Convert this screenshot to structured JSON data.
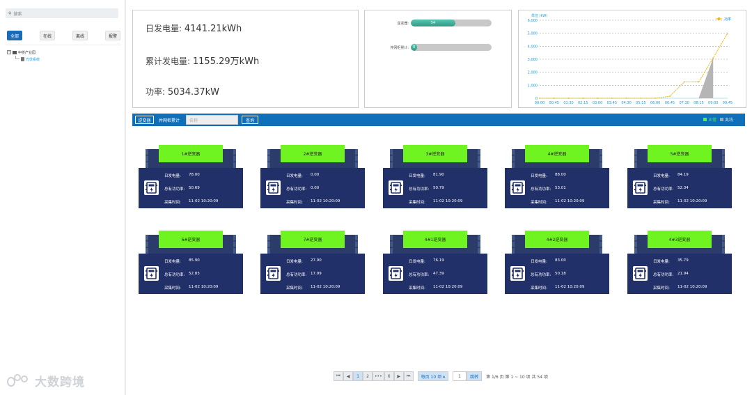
{
  "sidebar": {
    "search_placeholder": "搜索",
    "filters": [
      "全部",
      "在线",
      "离线",
      "报警"
    ],
    "tree_root": "中侨产业园",
    "tree_child": "光伏系统"
  },
  "summary": {
    "daily_label": "日发电量:",
    "daily_value": "4141.21kWh",
    "total_label": "累计发电量:",
    "total_value": "1155.29万kWh",
    "power_label": "功率:",
    "power_value": "5034.37kW"
  },
  "progress": [
    {
      "label": "逆变器:",
      "value": "54",
      "fraction": 0.55
    },
    {
      "label": "并网柜累计:",
      "value": "0",
      "fraction": 0.08
    }
  ],
  "chart_data": {
    "type": "line",
    "ylabel": "kW",
    "ylabel_prefix": "单位",
    "ylim": [
      0,
      6000
    ],
    "yticks": [
      "0",
      "1,000",
      "2,000",
      "3,000",
      "4,000",
      "5,000",
      "6,000"
    ],
    "categories": [
      "00:00",
      "00:45",
      "01:30",
      "02:15",
      "03:00",
      "03:45",
      "04:30",
      "05:15",
      "06:00",
      "06:45",
      "07:30",
      "08:15",
      "09:00",
      "09:45"
    ],
    "series": [
      {
        "name": "功率",
        "color": "#f5b700",
        "values": [
          0,
          0,
          0,
          0,
          0,
          0,
          0,
          0,
          0,
          150,
          1250,
          1250,
          3100,
          5000
        ]
      }
    ],
    "legend": "top-right",
    "grid": true
  },
  "toolbar": {
    "btn_inverter": "逆变器",
    "tab_grid": "并网柜累计",
    "name_placeholder": "名称",
    "btn_query": "查询",
    "legend_online": "正常",
    "legend_offline": "离线",
    "online_color": "#4ef24e",
    "offline_color": "#9aa9b5"
  },
  "card_labels": {
    "daily": "日发电量:",
    "power": "总有功功率:",
    "time": "采集时间:"
  },
  "cards": [
    {
      "name": "1#逆变器",
      "daily": "78.00",
      "power": "50.69",
      "time": "11-02 10:20:09"
    },
    {
      "name": "2#逆变器",
      "daily": "0.00",
      "power": "0.00",
      "time": "11-02 10:20:09"
    },
    {
      "name": "3#逆变器",
      "daily": "81.90",
      "power": "50.79",
      "time": "11-02 10:20:09"
    },
    {
      "name": "4#逆变器",
      "daily": "88.00",
      "power": "53.01",
      "time": "11-02 10:20:09"
    },
    {
      "name": "5#逆变器",
      "daily": "84.19",
      "power": "52.34",
      "time": "11-02 10:20:09"
    },
    {
      "name": "6#逆变器",
      "daily": "85.90",
      "power": "52.83",
      "time": "11-02 10:20:09"
    },
    {
      "name": "7#逆变器",
      "daily": "27.90",
      "power": "17.99",
      "time": "11-02 10:20:09"
    },
    {
      "name": "4#1逆变器",
      "daily": "76.19",
      "power": "47.39",
      "time": "11-02 10:20:09"
    },
    {
      "name": "4#2逆变器",
      "daily": "83.00",
      "power": "50.18",
      "time": "11-02 10:20:09"
    },
    {
      "name": "4#3逆变器",
      "daily": "35.79",
      "power": "21.94",
      "time": "11-02 10:20:09"
    }
  ],
  "pager": {
    "first": "⏮",
    "prev": "◀",
    "p1": "1",
    "p2": "2",
    "ellipsis": "•••",
    "p6": "6",
    "next": "▶",
    "last": "⏭",
    "page_size": "每页 10 项",
    "page_input": "1",
    "jump": "跳转",
    "info": "第 1/6 页 第 1 ~ 10 项 共 54 项"
  },
  "watermark": "大数跨境"
}
